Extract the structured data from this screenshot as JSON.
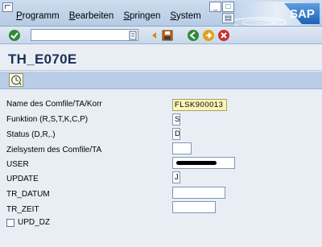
{
  "menubar": {
    "items": [
      "Programm",
      "Bearbeiten",
      "Springen",
      "System"
    ],
    "logo": "SAP"
  },
  "title": "TH_E070E",
  "form": {
    "fields": [
      {
        "label": "Name des Comfile/TA/Korr",
        "value": "FLSK900013"
      },
      {
        "label": "Funktion (R,S,T,K,C,P)",
        "value": "S"
      },
      {
        "label": "Status (D,R,.)",
        "value": "D"
      },
      {
        "label": "Zielsystem des Comfile/TA",
        "value": ""
      },
      {
        "label": "USER",
        "value": ""
      },
      {
        "label": "UPDATE",
        "value": "J"
      },
      {
        "label": "TR_DATUM",
        "value": ""
      },
      {
        "label": "TR_ZEIT",
        "value": ""
      }
    ],
    "checkbox_label": "UPD_DZ",
    "checkbox_checked": false
  },
  "colors": {
    "menubar": "#c3d5ea",
    "title": "#1c2f55",
    "apptoolbar": "#b7cde8",
    "highlight_field": "#fbf5b8"
  },
  "icons": [
    "system-menu-icon",
    "enter-check-icon",
    "back-arrow-icon",
    "save-icon",
    "previous-icon",
    "exit-icon",
    "cancel-icon",
    "execute-icon"
  ]
}
